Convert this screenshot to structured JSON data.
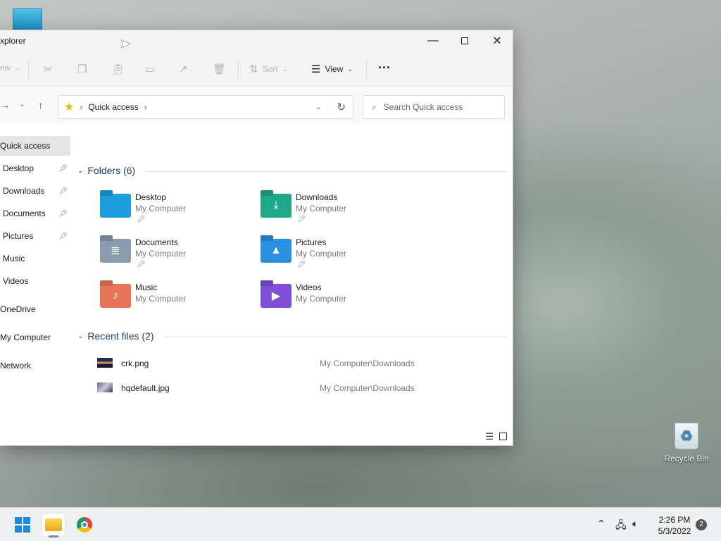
{
  "window": {
    "title": "xplorer",
    "minimize_icon": "minimize-icon",
    "maximize_icon": "maximize-icon",
    "close_icon": "close-icon"
  },
  "toolbar": {
    "new_label": "ew",
    "sort_label": "Sort",
    "view_label": "View",
    "more_label": "···"
  },
  "nav": {
    "address_location": "Quick access",
    "search_placeholder": "Search Quick access"
  },
  "sidebar": {
    "items": [
      {
        "label": "Quick access",
        "pinned": false
      },
      {
        "label": "Desktop",
        "pinned": true
      },
      {
        "label": "Downloads",
        "pinned": true
      },
      {
        "label": "Documents",
        "pinned": true
      },
      {
        "label": "Pictures",
        "pinned": true
      },
      {
        "label": "Music",
        "pinned": false
      },
      {
        "label": "Videos",
        "pinned": false
      },
      {
        "label": "OneDrive",
        "pinned": false
      },
      {
        "label": "My Computer",
        "pinned": false
      },
      {
        "label": "Network",
        "pinned": false
      }
    ]
  },
  "folders": {
    "header": "Folders (6)",
    "items": [
      {
        "name": "Desktop",
        "location": "My Computer",
        "pinned": true,
        "color": "#1e9ee0"
      },
      {
        "name": "Downloads",
        "location": "My Computer",
        "pinned": true,
        "color": "#1fa88a"
      },
      {
        "name": "Documents",
        "location": "My Computer",
        "pinned": true,
        "color": "#8b9bb0"
      },
      {
        "name": "Pictures",
        "location": "My Computer",
        "pinned": true,
        "color": "#2b8fe0"
      },
      {
        "name": "Music",
        "location": "My Computer",
        "pinned": false,
        "color": "#e8745a"
      },
      {
        "name": "Videos",
        "location": "My Computer",
        "pinned": false,
        "color": "#7f4fd6"
      }
    ]
  },
  "recent": {
    "header": "Recent files (2)",
    "items": [
      {
        "name": "crk.png",
        "path": "My Computer\\Downloads"
      },
      {
        "name": "hqdefault.jpg",
        "path": "My Computer\\Downloads"
      }
    ]
  },
  "desktop": {
    "recycle_bin_label": "Recycle Bin"
  },
  "taskbar": {
    "time": "2:26 PM",
    "date": "5/3/2022",
    "notification_count": "2"
  }
}
